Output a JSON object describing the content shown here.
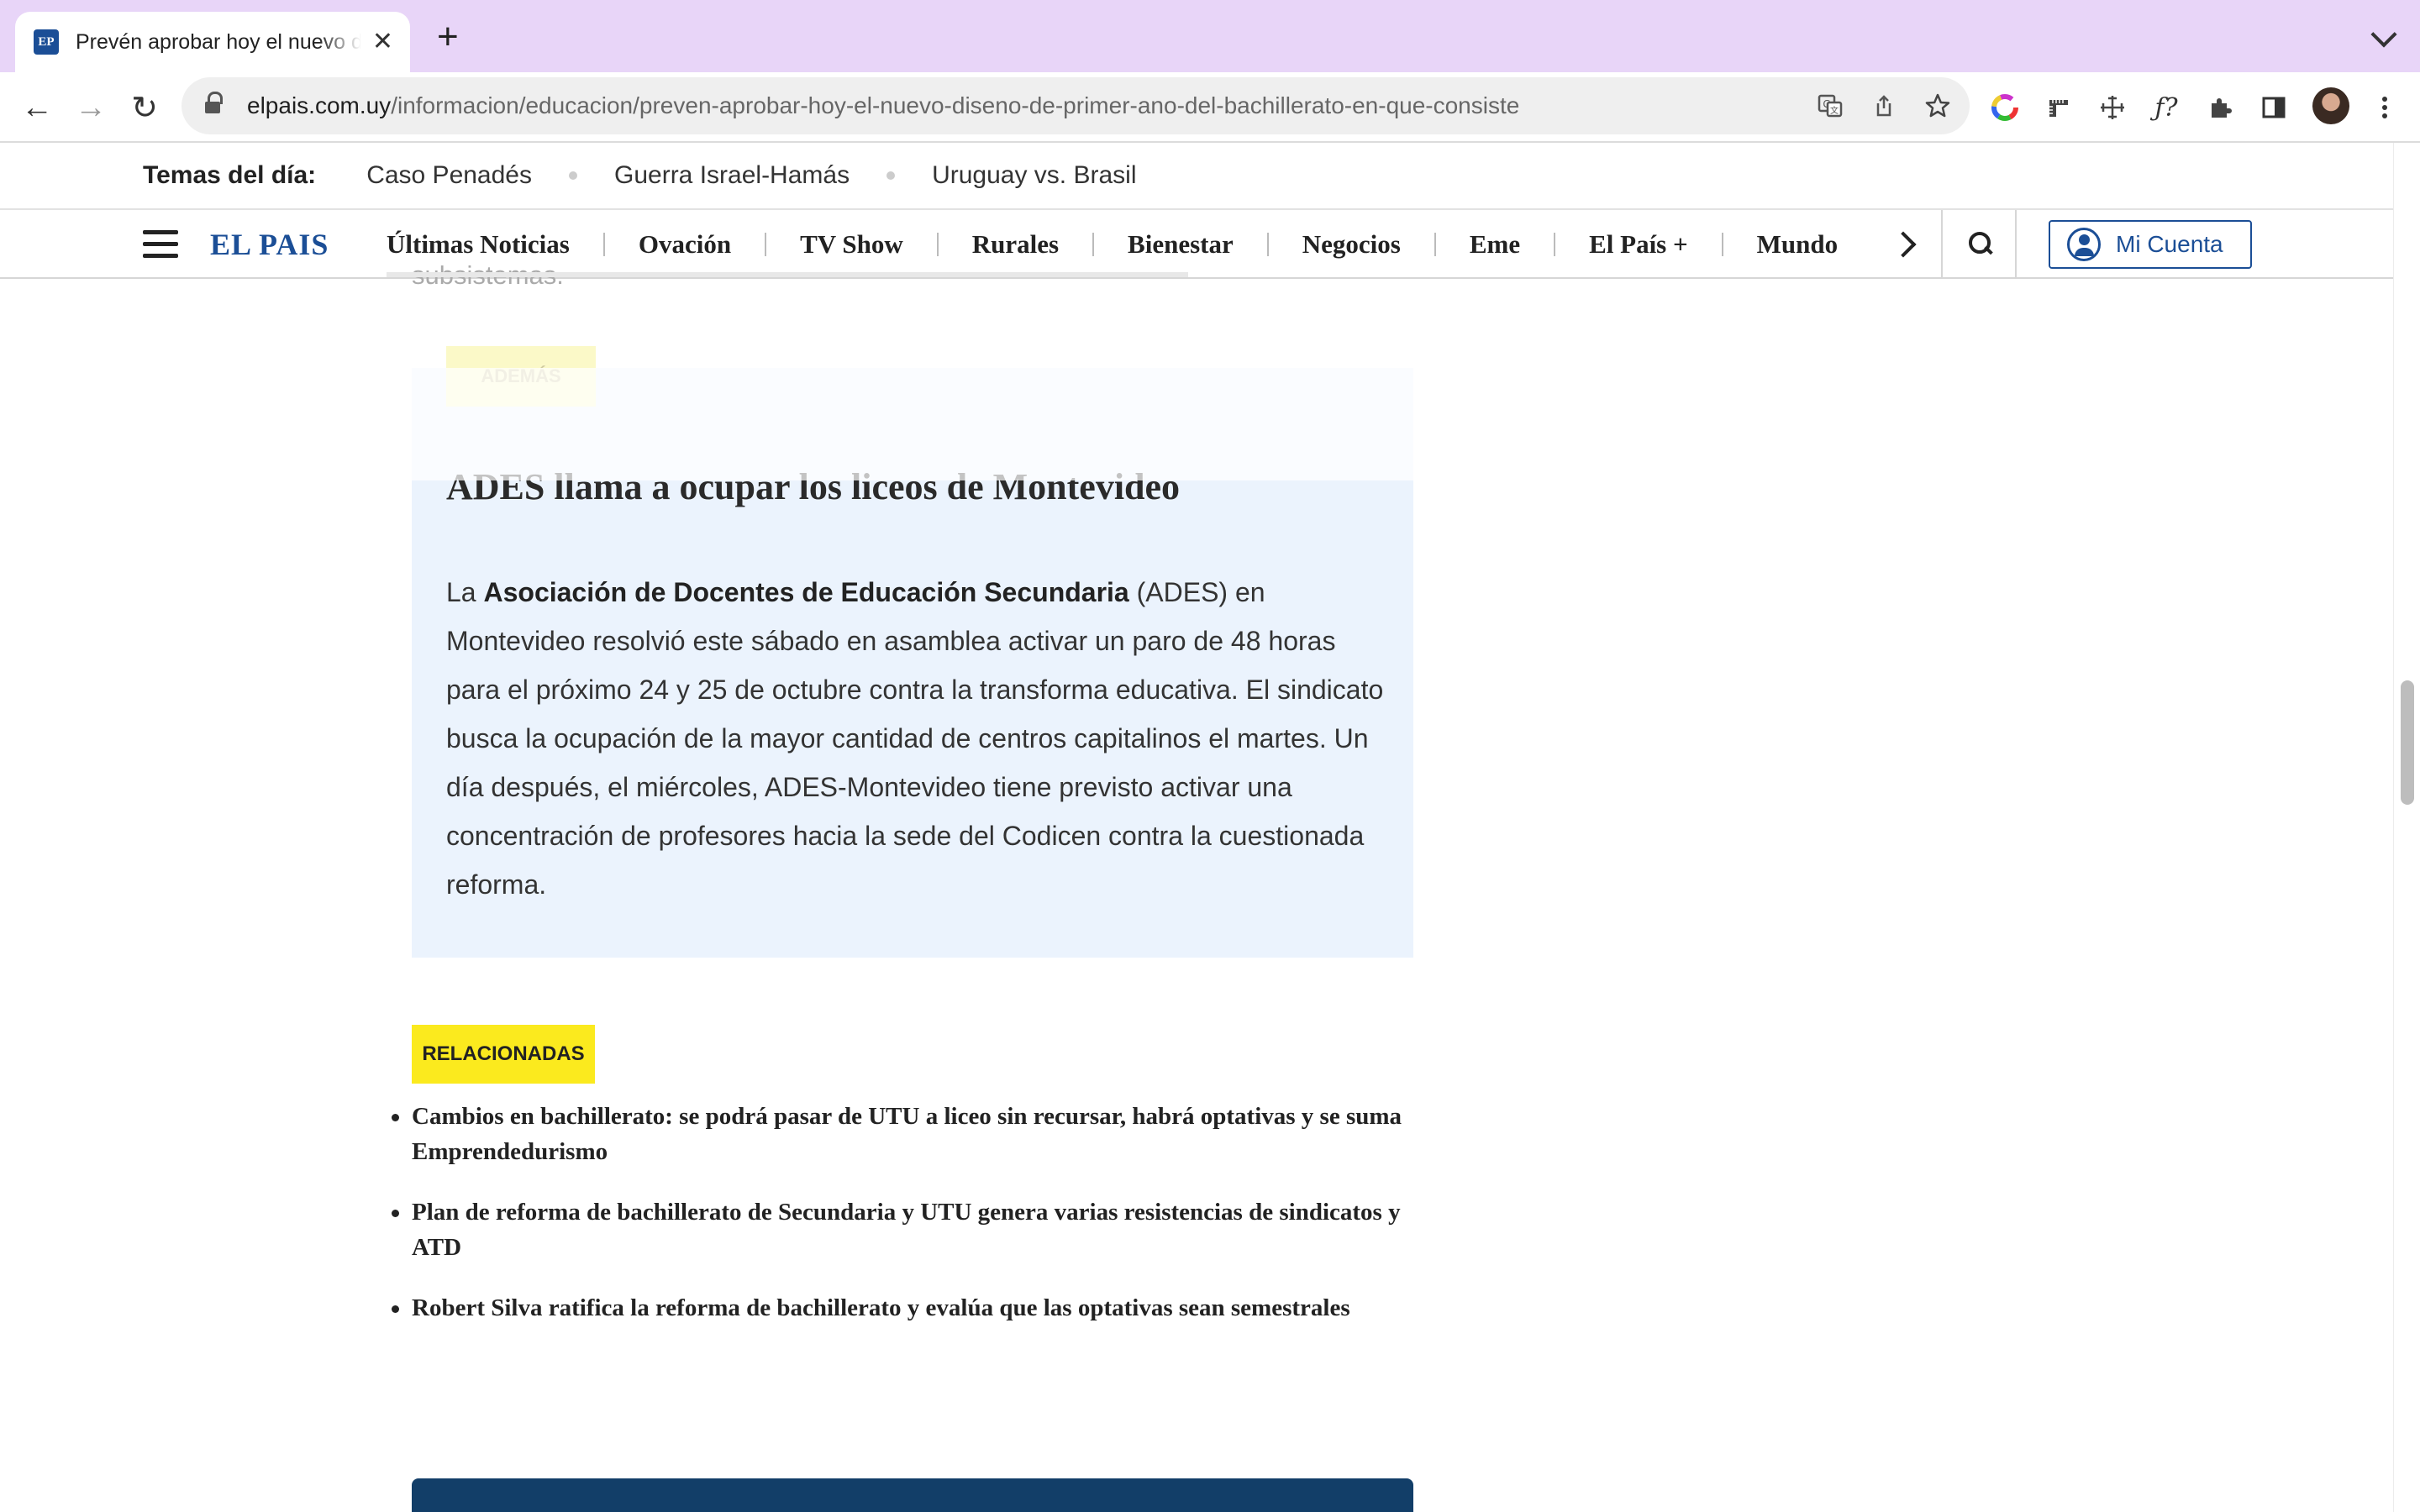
{
  "browser": {
    "tab_title": "Prevén aprobar hoy el nuevo diseño",
    "tab_favicon_text": "EP",
    "close_glyph": "✕",
    "newtab_glyph": "+",
    "url_host": "elpais.com.uy",
    "url_path": "/informacion/educacion/preven-aprobar-hoy-el-nuevo-diseno-de-primer-ano-del-bachillerato-en-que-consiste",
    "back_glyph": "←",
    "forward_glyph": "→",
    "reload_glyph": "↻",
    "icons": [
      "translate-icon",
      "share-icon",
      "bookmark-star-icon",
      "color-picker-icon",
      "ruler-icon",
      "move-icon",
      "font-icon",
      "extensions-icon",
      "side-panel-icon",
      "profile-avatar",
      "menu-icon"
    ]
  },
  "topics": {
    "label": "Temas del día:",
    "items": [
      "Caso Penadés",
      "Guerra Israel-Hamás",
      "Uruguay vs. Brasil"
    ]
  },
  "nav": {
    "logo": "EL PAIS",
    "items": [
      "Últimas Noticias",
      "Ovación",
      "TV Show",
      "Rurales",
      "Bienestar",
      "Negocios",
      "Eme",
      "El País +",
      "Mundo"
    ],
    "account_label": "Mi Cuenta"
  },
  "article": {
    "faded_text": "subsistemas.",
    "ademas": {
      "tag": "ADEMÁS",
      "title": "ADES llama a ocupar los liceos de Montevideo",
      "body_prefix": "La ",
      "body_bold": "Asociación de Docentes de Educación Secundaria",
      "body_rest": " (ADES) en Montevideo resolvió este sábado en asamblea activar un paro de 48 horas para el próximo 24 y 25 de octubre contra la transforma educativa. El sindicato busca la ocupación de la mayor cantidad de centros capitalinos el martes. Un día después, el miércoles, ADES-Montevideo tiene previsto activar una concentración de profesores hacia la sede del Codicen contra la cuestionada reforma."
    },
    "related": {
      "tag": "RELACIONADAS",
      "items": [
        "Cambios en bachillerato: se podrá pasar de UTU a liceo sin recursar, habrá optativas y se suma Emprendedurismo",
        "Plan de reforma de bachillerato de Secundaria y UTU genera varias resistencias de sindicatos y ATD",
        "Robert Silva ratifica la reforma de bachillerato y evalúa que las optativas sean semestrales"
      ]
    }
  },
  "colors": {
    "tabbar_bg": "#e8d5f8",
    "brand_blue": "#1b4e96",
    "ademas_bg": "#ebf3fd",
    "related_tag_bg": "#fbea1e",
    "footer_block": "#123e68"
  }
}
